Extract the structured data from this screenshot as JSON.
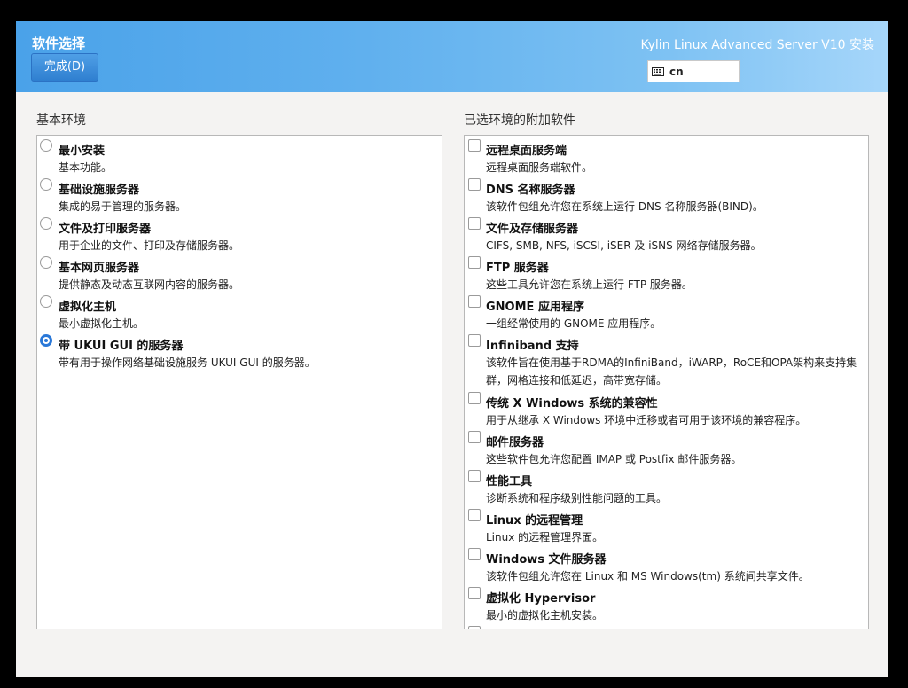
{
  "header": {
    "title": "软件选择",
    "done_label": "完成(D)",
    "product": "Kylin Linux Advanced Server V10 安装",
    "keyboard": "cn",
    "keyboard_icon": "keyboard-icon"
  },
  "left": {
    "label": "基本环境",
    "items": [
      {
        "name": "最小安装",
        "desc": "基本功能。",
        "selected": false
      },
      {
        "name": "基础设施服务器",
        "desc": "集成的易于管理的服务器。",
        "selected": false
      },
      {
        "name": "文件及打印服务器",
        "desc": "用于企业的文件、打印及存储服务器。",
        "selected": false
      },
      {
        "name": "基本网页服务器",
        "desc": "提供静态及动态互联网内容的服务器。",
        "selected": false
      },
      {
        "name": "虚拟化主机",
        "desc": "最小虚拟化主机。",
        "selected": false
      },
      {
        "name": "带 UKUI GUI 的服务器",
        "desc": "带有用于操作网络基础设施服务 UKUI GUI 的服务器。",
        "selected": true
      }
    ]
  },
  "right": {
    "label": "已选环境的附加软件",
    "items": [
      {
        "name": "远程桌面服务端",
        "desc": "远程桌面服务端软件。"
      },
      {
        "name": "DNS 名称服务器",
        "desc": "该软件包组允许您在系统上运行 DNS 名称服务器(BIND)。"
      },
      {
        "name": "文件及存储服务器",
        "desc": "CIFS, SMB, NFS, iSCSI, iSER 及 iSNS 网络存储服务器。"
      },
      {
        "name": "FTP 服务器",
        "desc": "这些工具允许您在系统上运行 FTP 服务器。"
      },
      {
        "name": "GNOME 应用程序",
        "desc": "一组经常使用的 GNOME 应用程序。"
      },
      {
        "name": "Infiniband 支持",
        "desc": "该软件旨在使用基于RDMA的InfiniBand，iWARP，RoCE和OPA架构来支持集群，网格连接和低延迟，高带宽存储。"
      },
      {
        "name": "传统 X Windows 系统的兼容性",
        "desc": "用于从继承 X Windows 环境中迁移或者可用于该环境的兼容程序。"
      },
      {
        "name": "邮件服务器",
        "desc": "这些软件包允许您配置 IMAP 或 Postfix 邮件服务器。"
      },
      {
        "name": "性能工具",
        "desc": "诊断系统和程序级别性能问题的工具。"
      },
      {
        "name": "Linux 的远程管理",
        "desc": "Linux 的远程管理界面。"
      },
      {
        "name": "Windows 文件服务器",
        "desc": "该软件包组允许您在 Linux 和 MS Windows(tm) 系统间共享文件。"
      },
      {
        "name": "虚拟化 Hypervisor",
        "desc": "最小的虚拟化主机安装。"
      }
    ]
  },
  "colors": {
    "header_start": "#4aa2e9",
    "header_end": "#a6d6fa",
    "accent": "#2a78d8"
  }
}
